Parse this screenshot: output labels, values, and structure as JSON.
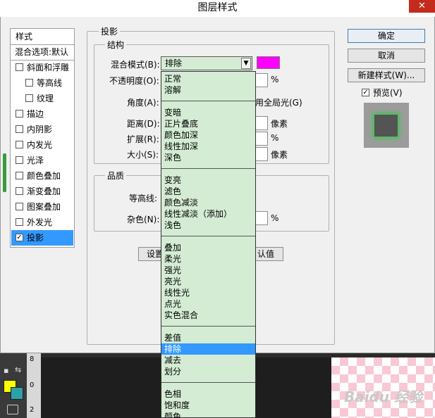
{
  "window": {
    "title": "图层样式",
    "close": "✕"
  },
  "left_panel": {
    "header": "样式",
    "blend_options": "混合选项:默认",
    "items": [
      {
        "label": "斜面和浮雕",
        "checked": false
      },
      {
        "label": "等高线",
        "checked": false
      },
      {
        "label": "纹理",
        "checked": false
      },
      {
        "label": "描边",
        "checked": false
      },
      {
        "label": "内阴影",
        "checked": false
      },
      {
        "label": "内发光",
        "checked": false
      },
      {
        "label": "光泽",
        "checked": false
      },
      {
        "label": "颜色叠加",
        "checked": false
      },
      {
        "label": "渐变叠加",
        "checked": false
      },
      {
        "label": "图案叠加",
        "checked": false
      },
      {
        "label": "外发光",
        "checked": false
      },
      {
        "label": "投影",
        "checked": true
      }
    ]
  },
  "main": {
    "group_title": "投影",
    "structure": {
      "title": "结构",
      "blend_mode_label": "混合模式(B):",
      "blend_mode_value": "排除",
      "blend_color": "#ff00ff",
      "opacity_label": "不透明度(O):",
      "opacity_unit": "%",
      "angle_label": "角度(A):",
      "global_light": "用全局光(G)",
      "distance_label": "距离(D):",
      "distance_unit": "像素",
      "spread_label": "扩展(R):",
      "spread_unit": "%",
      "size_label": "大小(S):",
      "size_unit": "像素"
    },
    "quality": {
      "title": "品质",
      "contour_label": "等高线:",
      "noise_label": "杂色(N):",
      "noise_unit": "%"
    },
    "set_default_partial": "设置",
    "reset_default_partial": "认值"
  },
  "dropdown": {
    "groups": [
      [
        "正常",
        "溶解"
      ],
      [
        "变暗",
        "正片叠底",
        "颜色加深",
        "线性加深",
        "深色"
      ],
      [
        "变亮",
        "滤色",
        "颜色减淡",
        "线性减淡（添加）",
        "浅色"
      ],
      [
        "叠加",
        "柔光",
        "强光",
        "亮光",
        "线性光",
        "点光",
        "实色混合"
      ],
      [
        "差值",
        "排除",
        "减去",
        "划分"
      ],
      [
        "色相",
        "饱和度",
        "颜色"
      ]
    ],
    "selected": "排除"
  },
  "right_buttons": {
    "ok": "确定",
    "cancel": "取消",
    "new_style": "新建样式(W)...",
    "preview": "预览(V)",
    "preview_checked": true
  },
  "bottom": {
    "ruler_ticks": [
      "8",
      "0",
      "2"
    ],
    "watermark": "Baidu 经验"
  }
}
